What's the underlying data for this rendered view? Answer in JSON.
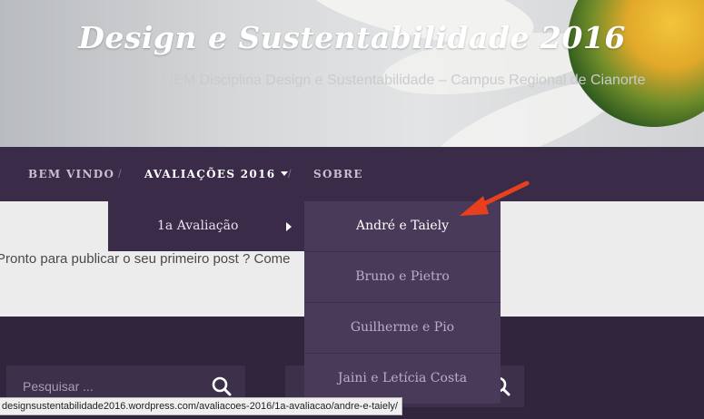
{
  "header": {
    "site_title": "Design e Sustentabilidade 2016",
    "site_description": "UEM Disciplina Design e Sustentabilidade – Campus Regional de Cianorte"
  },
  "nav": {
    "items": [
      {
        "label": "BEM VINDO"
      },
      {
        "label": "AVALIAÇÕES 2016",
        "active": true
      },
      {
        "label": "SOBRE"
      }
    ],
    "separator": "/"
  },
  "dropdown": {
    "level1_label": "1a Avaliação",
    "level2_items": [
      {
        "label": "André e Taiely"
      },
      {
        "label": "Bruno e Pietro"
      },
      {
        "label": "Guilherme e Pio"
      },
      {
        "label": "Jaini e Letícia Costa"
      }
    ]
  },
  "content": {
    "text": "Pronto para publicar o seu primeiro post ? Come"
  },
  "footer": {
    "search_placeholder": "Pesquisar ..."
  },
  "status_bar": {
    "url": "designsustentabilidade2016.wordpress.com/avaliacoes-2016/1a-avaliacao/andre-e-taiely/"
  },
  "colors": {
    "nav_bg": "#3a2c48",
    "dropdown_bg": "#483a58",
    "footer_bg": "#31253d",
    "annotation_arrow": "#e8401e"
  }
}
